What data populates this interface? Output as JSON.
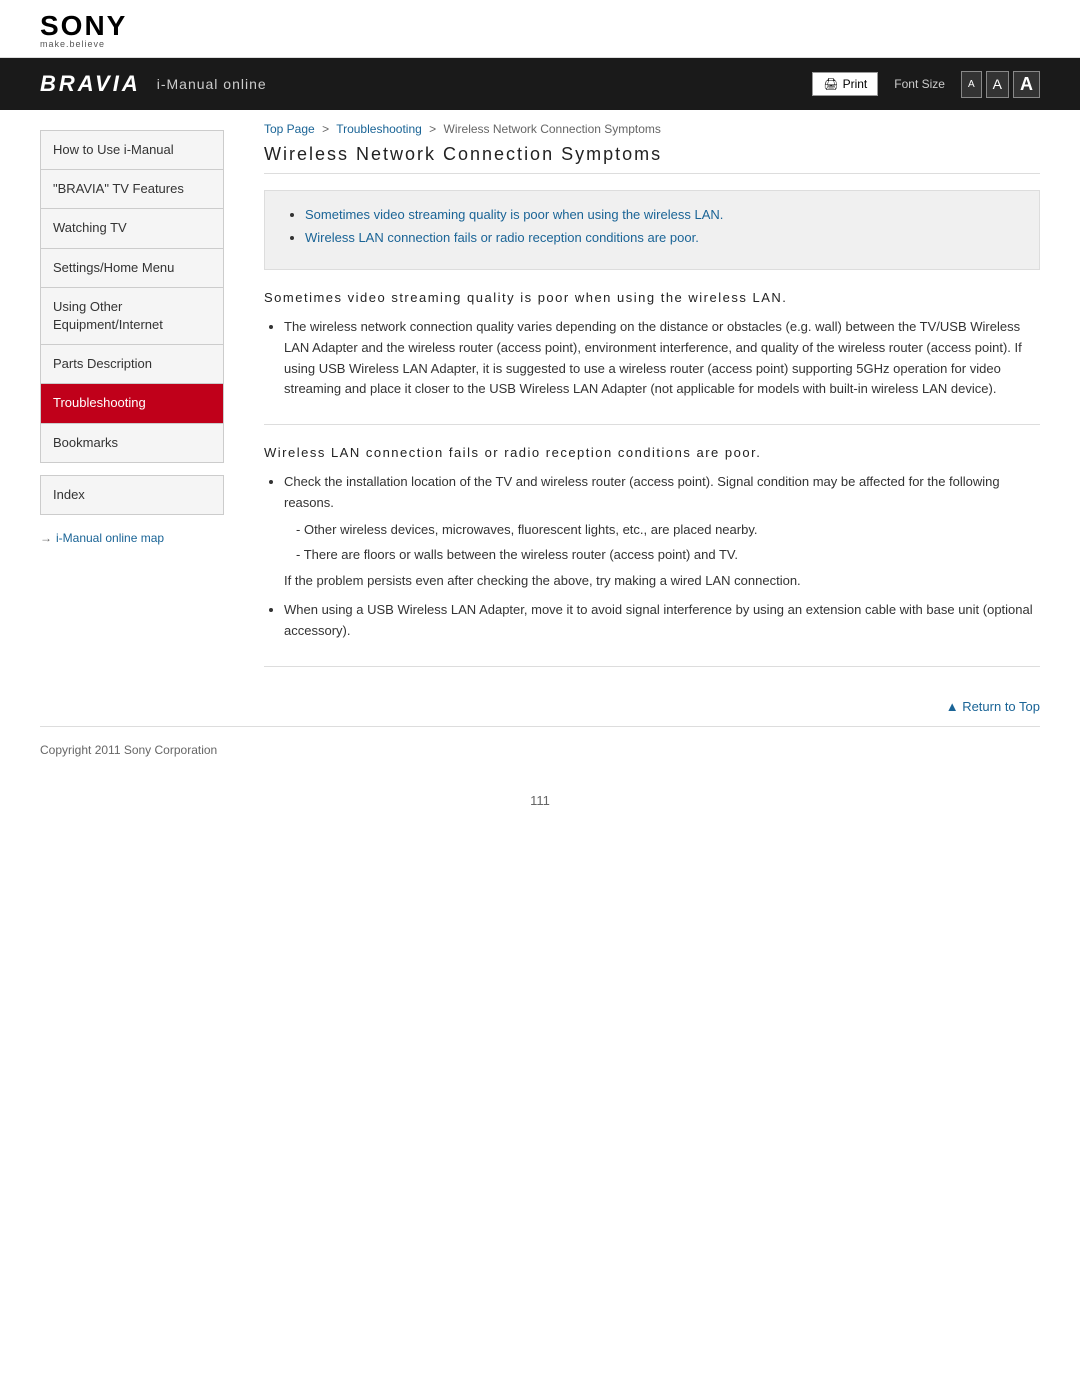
{
  "header": {
    "sony_logo": "SONY",
    "make_believe": "make.believe",
    "bravia_logo": "BRAVIA",
    "subtitle": "i-Manual online",
    "print_label": "Print",
    "font_size_label": "Font Size",
    "font_size_small": "A",
    "font_size_medium": "A",
    "font_size_large": "A"
  },
  "breadcrumb": {
    "top_page": "Top Page",
    "sep1": ">",
    "troubleshooting": "Troubleshooting",
    "sep2": ">",
    "current": "Wireless Network Connection Symptoms"
  },
  "sidebar": {
    "items": [
      {
        "label": "How to Use i-Manual",
        "active": false
      },
      {
        "label": "\"BRAVIA\" TV Features",
        "active": false
      },
      {
        "label": "Watching TV",
        "active": false
      },
      {
        "label": "Settings/Home Menu",
        "active": false
      },
      {
        "label": "Using Other Equipment/Internet",
        "active": false
      },
      {
        "label": "Parts Description",
        "active": false
      },
      {
        "label": "Troubleshooting",
        "active": true
      },
      {
        "label": "Bookmarks",
        "active": false
      }
    ],
    "index_label": "Index",
    "map_link": "i-Manual online map"
  },
  "page": {
    "title": "Wireless Network Connection Symptoms",
    "summary_links": [
      "Sometimes video streaming quality is poor when using the wireless LAN.",
      "Wireless LAN connection fails or radio reception conditions are poor."
    ],
    "section1": {
      "heading": "Sometimes video streaming quality is poor when using the wireless LAN.",
      "bullet1": "The wireless network connection quality varies depending on the distance or obstacles (e.g. wall) between the TV/USB Wireless LAN Adapter and the wireless router (access point), environment interference, and quality of the wireless router (access point). If using USB Wireless LAN Adapter, it is suggested to use a wireless router (access point) supporting 5GHz operation for video streaming and place it closer to the USB Wireless LAN Adapter (not applicable for models with built-in wireless LAN device)."
    },
    "section2": {
      "heading": "Wireless LAN connection fails or radio reception conditions are poor.",
      "bullet1": "Check the installation location of the TV and wireless router (access point). Signal condition may be affected for the following reasons.",
      "sub1": "Other wireless devices, microwaves, fluorescent lights, etc., are placed nearby.",
      "sub2": "There are floors or walls between the wireless router (access point) and TV.",
      "note": "If the problem persists even after checking the above, try making a wired LAN connection.",
      "bullet2": "When using a USB Wireless LAN Adapter, move it to avoid signal interference by using an extension cable with base unit (optional accessory)."
    },
    "return_to_top": "Return to Top",
    "page_number": "111"
  },
  "footer": {
    "copyright": "Copyright 2011 Sony Corporation"
  }
}
